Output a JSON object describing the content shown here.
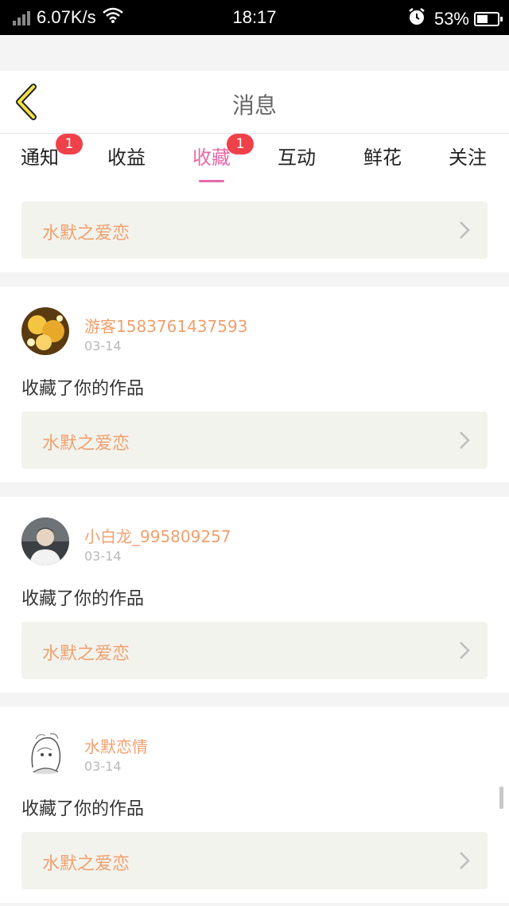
{
  "status_bar": {
    "net_speed": "6.07K/s",
    "time": "18:17",
    "battery": "53%",
    "battery_level": 0.53,
    "icons": [
      "signal-icon",
      "wifi-icon",
      "alarm-icon",
      "battery-icon"
    ]
  },
  "header": {
    "title": "消息",
    "back_icon": "chevron-left-icon"
  },
  "tabs": [
    {
      "label": "通知",
      "badge": "1",
      "active": false
    },
    {
      "label": "收益",
      "badge": "",
      "active": false
    },
    {
      "label": "收藏",
      "badge": "1",
      "active": true
    },
    {
      "label": "互动",
      "badge": "",
      "active": false
    },
    {
      "label": "鲜花",
      "badge": "",
      "active": false
    },
    {
      "label": "关注",
      "badge": "",
      "active": false
    }
  ],
  "colors": {
    "accent": "#e66aa7",
    "badge": "#f0404a",
    "username": "#f0a06e",
    "work_bg": "#f3f3ee"
  },
  "feed": {
    "partial_item": {
      "work_title": "水默之爱恋"
    },
    "items": [
      {
        "username": "游客1583761437593",
        "date": "03-14",
        "message": "收藏了你的作品",
        "work_title": "水默之爱恋",
        "avatar": "avatar-image"
      },
      {
        "username": "小白龙_995809257",
        "date": "03-14",
        "message": "收藏了你的作品",
        "work_title": "水默之爱恋",
        "avatar": "avatar-image"
      },
      {
        "username": "水默恋情",
        "date": "03-14",
        "message": "收藏了你的作品",
        "work_title": "水默之爱恋",
        "avatar": "avatar-image"
      }
    ]
  }
}
